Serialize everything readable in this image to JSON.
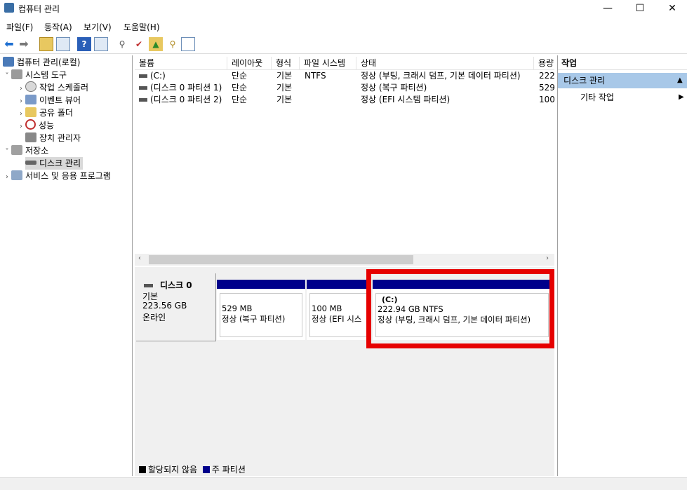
{
  "window": {
    "title": "컴퓨터 관리",
    "minimize": "—",
    "maximize": "☐",
    "close": "✕"
  },
  "menu": [
    "파일(F)",
    "동작(A)",
    "보기(V)",
    "도움말(H)"
  ],
  "tree": {
    "root": "컴퓨터 관리(로컬)",
    "system_tools": "시스템 도구",
    "task_scheduler": "작업 스케줄러",
    "event_viewer": "이벤트 뷰어",
    "shared_folders": "공유 폴더",
    "performance": "성능",
    "device_manager": "장치 관리자",
    "storage": "저장소",
    "disk_management": "디스크 관리",
    "services_apps": "서비스 및 응용 프로그램"
  },
  "columns": [
    "볼륨",
    "레이아웃",
    "형식",
    "파일 시스템",
    "상태",
    "용량"
  ],
  "volumes": [
    {
      "name": "(C:)",
      "layout": "단순",
      "type": "기본",
      "fs": "NTFS",
      "status": "정상 (부팅, 크래시 덤프, 기본 데이터 파티션)",
      "capacity": "222"
    },
    {
      "name": "(디스크 0 파티션 1)",
      "layout": "단순",
      "type": "기본",
      "fs": "",
      "status": "정상 (복구 파티션)",
      "capacity": "529"
    },
    {
      "name": "(디스크 0 파티션 2)",
      "layout": "단순",
      "type": "기본",
      "fs": "",
      "status": "정상 (EFI 시스템 파티션)",
      "capacity": "100"
    }
  ],
  "disk": {
    "name": "디스크 0",
    "kind": "기본",
    "size": "223.56 GB",
    "state": "온라인"
  },
  "partitions": [
    {
      "label": "",
      "size": "529 MB",
      "status": "정상 (복구 파티션)"
    },
    {
      "label": "",
      "size": "100 MB",
      "status": "정상 (EFI 시스"
    },
    {
      "label": "(C:)",
      "size": "222.94 GB NTFS",
      "status": "정상 (부팅, 크래시 덤프, 기본 데이터 파티션)"
    }
  ],
  "legend": {
    "unallocated": "할당되지 않음",
    "primary": "주 파티션"
  },
  "actions": {
    "title": "작업",
    "section": "디스크 관리",
    "more": "기타 작업"
  },
  "colors": {
    "primary_partition": "#00008b",
    "highlight": "#e60000",
    "selection": "#a8c8e8"
  }
}
